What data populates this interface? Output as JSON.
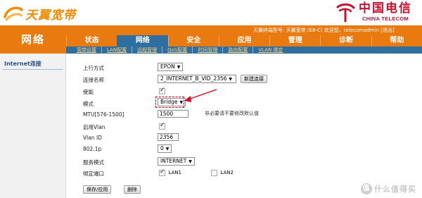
{
  "brand": {
    "left_logo_text": "天翼宽带",
    "right_logo_cn": "中国电信",
    "right_logo_en": "CHINA TELECOM",
    "accent_orange": "#e97a10",
    "active_blue": "#2f6f9f",
    "telecom_red": "#c8102e"
  },
  "header": {
    "section_title": "网络",
    "device_info": "天翼终端型号: 天翼宽带 (E8-C)  欢迎您，telecomadmin",
    "logout_label": "[退出]"
  },
  "main_tabs": [
    {
      "label": "状态",
      "active": false
    },
    {
      "label": "网络",
      "active": true
    },
    {
      "label": "安全",
      "active": false
    },
    {
      "label": "应用",
      "active": false
    },
    {
      "label": "管理",
      "active": false
    },
    {
      "label": "诊断",
      "active": false
    },
    {
      "label": "帮助",
      "active": false
    }
  ],
  "sub_tabs": [
    "宽带设置",
    "LAN配置",
    "远程管理",
    "QoS配置",
    "时间管理",
    "路由配置",
    "VLAN 绑定"
  ],
  "sidebar": {
    "items": [
      {
        "label": "Internet连接",
        "active": true
      }
    ]
  },
  "form": {
    "uplink_mode": {
      "label": "上行方式",
      "value": "EPON"
    },
    "connection_name": {
      "label": "连接名称",
      "value": "2_INTERNET_B_VID_2356",
      "new_button": "新建连接"
    },
    "enable": {
      "label": "使能",
      "checked": true
    },
    "mode": {
      "label": "模式",
      "value": "Bridge"
    },
    "mtu": {
      "label": "MTU[576-1500]",
      "value": "1500",
      "hint": "非必要请不要修改默认值"
    },
    "enable_vlan": {
      "label": "启用Vlan",
      "checked": true
    },
    "vlan_id": {
      "label": "Vlan ID",
      "value": "2356"
    },
    "priority": {
      "label": "802.1p",
      "value": "0"
    },
    "service_mode": {
      "label": "服务模式",
      "value": "INTERNET"
    },
    "bind_port": {
      "label": "绑定端口",
      "ports": [
        {
          "label": "LAN1",
          "checked": true
        },
        {
          "label": "LAN2",
          "checked": false
        }
      ]
    }
  },
  "actions": {
    "save_label": "保存/应用",
    "delete_label": "删除"
  },
  "watermark": {
    "icon": "值",
    "text": "什么值得买"
  }
}
